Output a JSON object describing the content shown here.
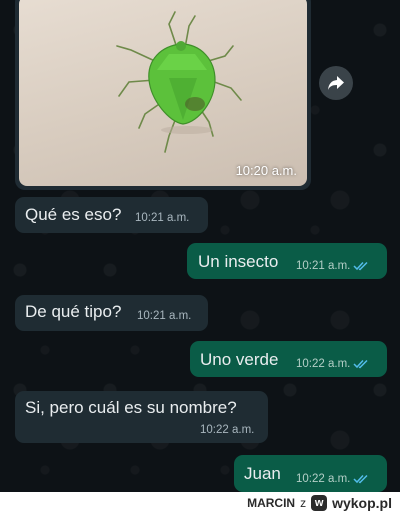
{
  "chat": {
    "photo": {
      "time": "10:20 a.m."
    },
    "messages": [
      {
        "text": "Qué es eso?",
        "time": "10:21 a.m.",
        "direction": "in"
      },
      {
        "text": "Un insecto",
        "time": "10:21 a.m.",
        "direction": "out"
      },
      {
        "text": "De qué tipo?",
        "time": "10:21 a.m.",
        "direction": "in"
      },
      {
        "text": "Uno verde",
        "time": "10:22 a.m.",
        "direction": "out"
      },
      {
        "text": "Si, pero cuál es su nombre?",
        "time": "10:22 a.m.",
        "direction": "in"
      },
      {
        "text": "Juan",
        "time": "10:22 a.m.",
        "direction": "out"
      }
    ]
  },
  "footer": {
    "user": "MARCIN",
    "connector": "z",
    "logo_letter": "w",
    "site": "wykop.pl"
  },
  "colors": {
    "incoming": "#1f2c33",
    "outgoing": "#0a5c47",
    "read_ticks": "#53bdeb"
  },
  "icons": [
    "forward-icon",
    "double-check-icon",
    "wykop-logo-icon"
  ]
}
